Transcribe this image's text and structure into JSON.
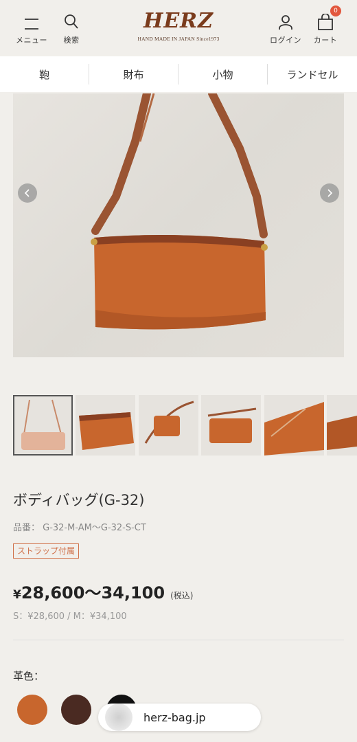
{
  "header": {
    "menu_label": "メニュー",
    "search_label": "検索",
    "logo_text": "HERZ",
    "logo_tagline": "HAND MADE IN JAPAN Since1973",
    "login_label": "ログイン",
    "cart_label": "カート",
    "cart_count": "0"
  },
  "categories": [
    {
      "label": "鞄"
    },
    {
      "label": "財布"
    },
    {
      "label": "小物"
    },
    {
      "label": "ランドセル"
    }
  ],
  "gallery": {
    "thumbnail_count": 6,
    "selected_index": 0
  },
  "product": {
    "title": "ボディバッグ(G-32)",
    "sku": "品番： G-32-M-AM〜G-32-S-CT",
    "badge": "ストラップ付属",
    "price_symbol": "¥",
    "price_range": "28,600〜34,100",
    "tax_note": "(税込)",
    "size_prices": "S：¥28,600 / M：¥34,100",
    "color_label": "革色：",
    "colors": [
      "#c8662d",
      "#4a2a22",
      "#111111"
    ]
  },
  "browser": {
    "url": "herz-bag.jp"
  },
  "colors": {
    "accent": "#d0714a",
    "brand": "#7a3b1c",
    "background": "#f1efeb"
  }
}
